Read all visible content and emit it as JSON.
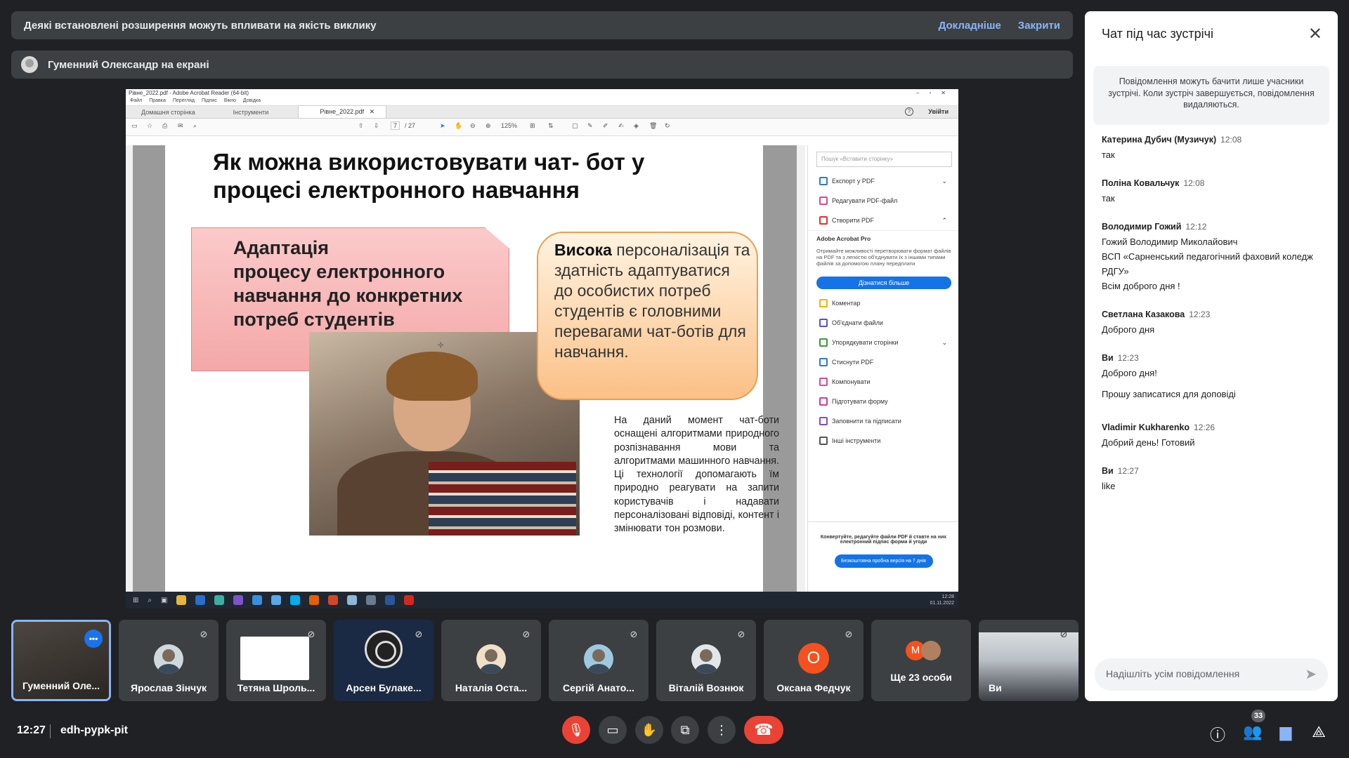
{
  "warning_banner": {
    "text": "Деякі встановлені розширення можуть впливати на якість виклику",
    "more_link": "Докладніше",
    "close_link": "Закрити"
  },
  "presenting_banner": {
    "text": "Гуменний Олександр на екрані"
  },
  "acrobat": {
    "title": "Рівне_2022.pdf - Adobe Acrobat Reader (64-bit)",
    "menu": [
      "Файл",
      "Правка",
      "Перегляд",
      "Підпис",
      "Вікно",
      "Довідка"
    ],
    "tabs": [
      "Домашня сторінка",
      "Інструменти",
      "Рівне_2022.pdf"
    ],
    "signin": "Увійти",
    "page_current": "7",
    "page_total": "/ 27",
    "zoom": "125%",
    "slide": {
      "title_line1": "Як можна використовувати чат- бот у",
      "title_line2": "процесі електронного навчання",
      "pink_lines": [
        "Адаптація",
        "процесу електронного",
        "навчання до конкретних",
        "потреб студентів"
      ],
      "orange_bold": "Висока",
      "orange_text": " персоналізація та здатність адаптуватися до особистих потреб студентів є головними перевагами чат-ботів для навчання.",
      "description": "На даний момент чат-боти оснащені алгоритмами природного розпізнавання мови та алгоритмами машинного навчання. Ці технології допомагають їм природно реагувати на запити користувачів і надавати персоналізовані відповіді, контент і змінювати тон розмови."
    },
    "right_pane": {
      "search_placeholder": "Пошук «Вставити сторінку»",
      "items_top": [
        "Експорт у PDF",
        "Редагувати PDF-файл",
        "Створити PDF"
      ],
      "pro_title": "Adobe Acrobat Pro",
      "pro_text": "Отримайте можливості перетворювати формат файлів на PDF та з легкістю об'єднувати їх з іншими типами файлів за допомогою плану передплати",
      "pro_button": "Дізнатися більше",
      "items_bottom": [
        "Коментар",
        "Об'єднати файли",
        "Упорядкувати сторінки",
        "Стиснути PDF",
        "Компонувати",
        "Підготувати форму",
        "Заповнити та підписати",
        "Інші інструменти"
      ],
      "footer_text": "Конвертуйте, редагуйте файли PDF й ставте на них електронний підпис форми й угоди",
      "footer_button": "Безкоштовна пробна версія на 7 днів"
    },
    "taskbar_time": "12:28",
    "taskbar_date": "01.11.2022"
  },
  "participants": [
    {
      "name": "Гуменний Оле...",
      "speaking": true
    },
    {
      "name": "Ярослав Зінчук"
    },
    {
      "name": "Тетяна Шроль..."
    },
    {
      "name": "Арсен Булаке..."
    },
    {
      "name": "Наталія Оста..."
    },
    {
      "name": "Сергій Анато..."
    },
    {
      "name": "Віталій Вознюк"
    },
    {
      "name": "Оксана Федчук",
      "initial": "O"
    },
    {
      "name": "Ще 23 особи",
      "initial": "М"
    },
    {
      "name": "Ви"
    }
  ],
  "bottom": {
    "time": "12:27",
    "meeting_code": "edh-pypk-pit",
    "people_count": "33"
  },
  "chat": {
    "title": "Чат під час зустрічі",
    "notice": "Повідомлення можуть бачити лише учасники зустрічі. Коли зустріч завершується, повідомлення видаляються.",
    "messages": [
      {
        "author": "Катерина Дубич (Музичук)",
        "time": "12:08",
        "lines": [
          "так"
        ]
      },
      {
        "author": "Поліна Ковальчук",
        "time": "12:08",
        "lines": [
          "так"
        ]
      },
      {
        "author": "Володимир Гожий",
        "time": "12:12",
        "lines": [
          "Гожий Володимир Миколайович",
          "ВСП «Сарненський педагогічний фаховий коледж",
          "РДГУ»",
          "Всім доброго дня !"
        ]
      },
      {
        "author": "Светлана Казакова",
        "time": "12:23",
        "lines": [
          "Доброго дня"
        ]
      },
      {
        "author": "Ви",
        "time": "12:23",
        "lines": [
          "Доброго дня!",
          "Прошу записатися для доповіді"
        ]
      },
      {
        "author": "Vladimir Kukharenko",
        "time": "12:26",
        "lines": [
          "Добрий день! Готовий"
        ]
      },
      {
        "author": "Ви",
        "time": "12:27",
        "lines": [
          "like"
        ]
      }
    ],
    "input_placeholder": "Надішліть усім повідомлення"
  }
}
